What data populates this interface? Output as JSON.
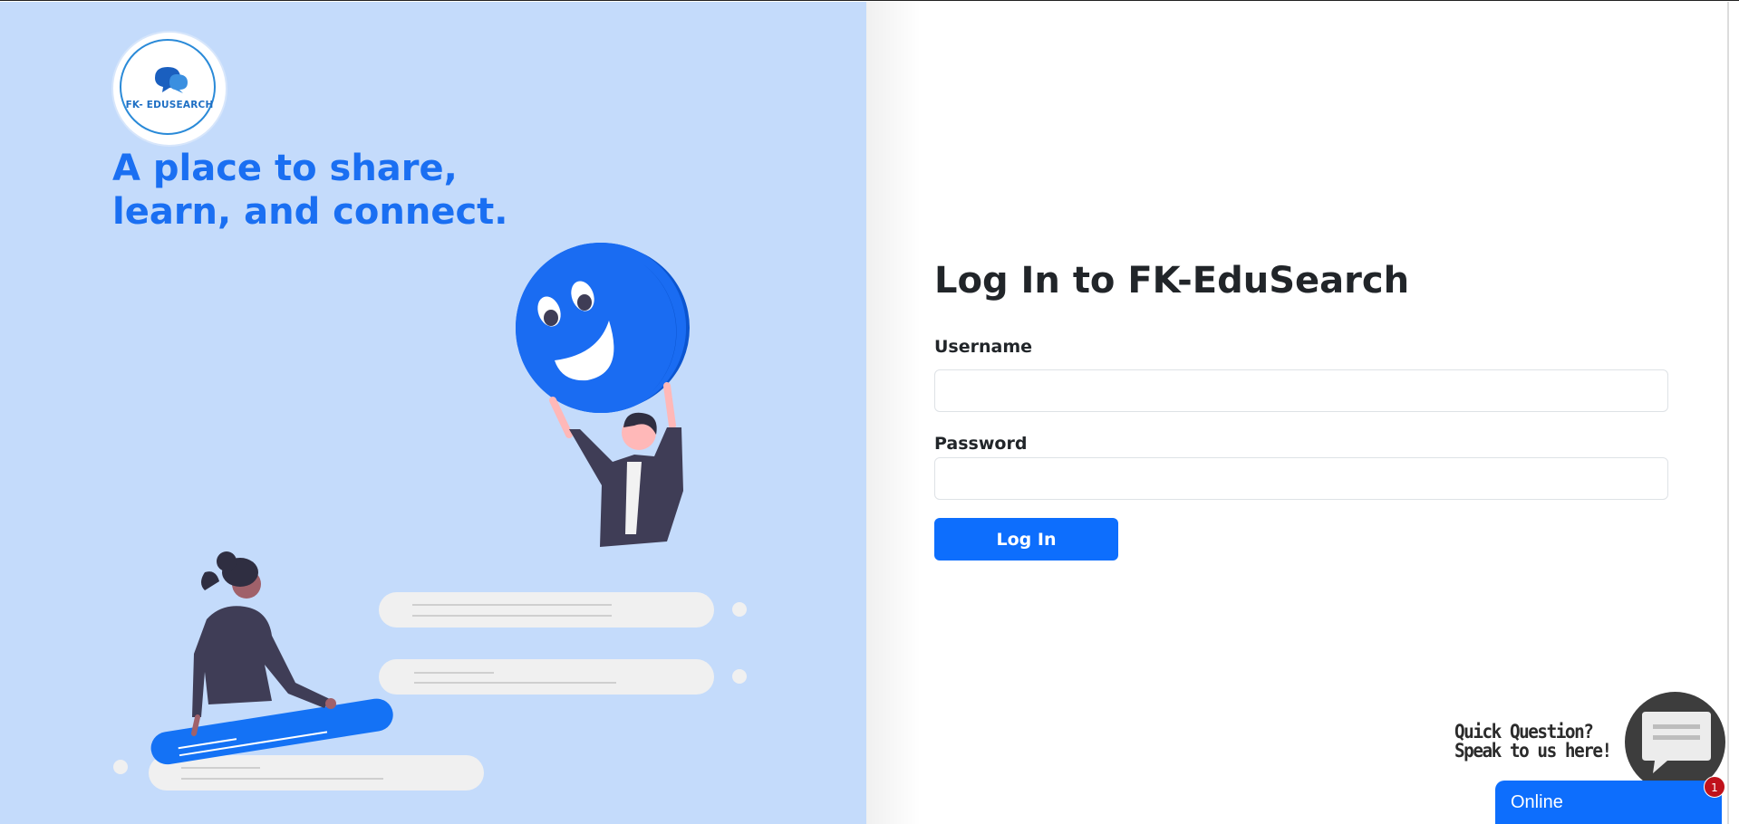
{
  "brand": {
    "logo_text": "FK- EDUSEARCH",
    "tagline_line1": "A place to share,",
    "tagline_line2": "learn, and connect."
  },
  "login": {
    "title": "Log In to FK-EduSearch",
    "username_label": "Username",
    "username_value": "",
    "password_label": "Password",
    "password_value": "",
    "submit_label": "Log In"
  },
  "chat": {
    "line1": "Quick Question?",
    "line2": "Speak to us here!",
    "badge_count": "1",
    "status": "Online",
    "icon": "chat-bubble-icon"
  },
  "colors": {
    "accent": "#0d6efd",
    "left_panel_bg": "#c4dbfb",
    "tagline": "#1a6ff2"
  }
}
